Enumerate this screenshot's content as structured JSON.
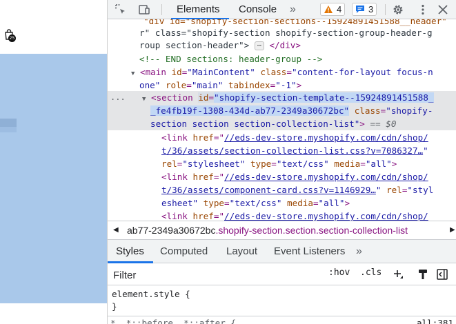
{
  "cart": {
    "count": "25"
  },
  "toolbar": {
    "tabs": [
      {
        "label": "Elements"
      },
      {
        "label": "Console"
      }
    ],
    "more_tabs": "»",
    "warnings": "4",
    "issues": "3"
  },
  "dom": {
    "lines": [
      {
        "text": "r\" class=\"shopify-section shopify-section-group-header-g"
      },
      {
        "text": "roup section-header\">"
      },
      {
        "chip": "⋯",
        "close": "</div>"
      },
      {
        "comment": "<!-- END sections: header-group -->"
      },
      {
        "tag": "<main",
        "a1": "id",
        "v1": "\"MainContent\"",
        "a2": "class",
        "v2": "\"content-for-layout focus-n"
      },
      {
        "v3": "one\"",
        "a3": "role",
        "v4": "\"main\"",
        "a4": "tabindex",
        "v5": "\"-1\"",
        "end": ">"
      },
      {
        "dots": "...",
        "tag": "<section",
        "a1": "id",
        "v1": "\"shopify-section-template--15924891451588_"
      },
      {
        "v2": "_fe4fb19f-1308-434d-ab77-2349a30672bc\"",
        "a2": "class",
        "v3": "\"shopify-"
      },
      {
        "v4": "section section section-collection-list\"",
        "end": ">",
        "eq": "== $0"
      },
      {
        "tag": "<link",
        "a1": "href",
        "v1": "//eds-dev-store.myshopify.com/cdn/shop/"
      },
      {
        "v2": "t/36/assets/section-collection-list.css?v=7086327…",
        "end": "\""
      },
      {
        "a2": "rel",
        "v3": "\"stylesheet\"",
        "a3": "type",
        "v4": "\"text/css\"",
        "a4": "media",
        "v5": "\"all\"",
        "end": ">"
      },
      {
        "tag": "<link",
        "a1": "href",
        "v1": "//eds-dev-store.myshopify.com/cdn/shop/"
      },
      {
        "v2": "t/36/assets/component-card.css?v=1146929…",
        "a2": "rel",
        "v3": "\"styl"
      },
      {
        "v4": "esheet\"",
        "a3": "type",
        "v5": "\"text/css\"",
        "a4": "media",
        "v6": "\"all\"",
        "end": ">"
      },
      {
        "tag": "<link",
        "a1": "href",
        "v1": "//eds-dev-store.myshopify.com/cdn/shop/"
      }
    ]
  },
  "breadcrumb": {
    "id_part": "ab77-2349a30672bc",
    "class_part": ".shopify-section.section.section-collection-list"
  },
  "styles": {
    "tabs": [
      "Styles",
      "Computed",
      "Layout",
      "Event Listeners"
    ],
    "more": "»",
    "filter_placeholder": "Filter",
    "hov": ":hov",
    "cls": ".cls",
    "rule_selector": "element.style {",
    "rule_close": "}",
    "next_rule": "*, *::before, *::after {",
    "next_rule_src": "all:381"
  }
}
